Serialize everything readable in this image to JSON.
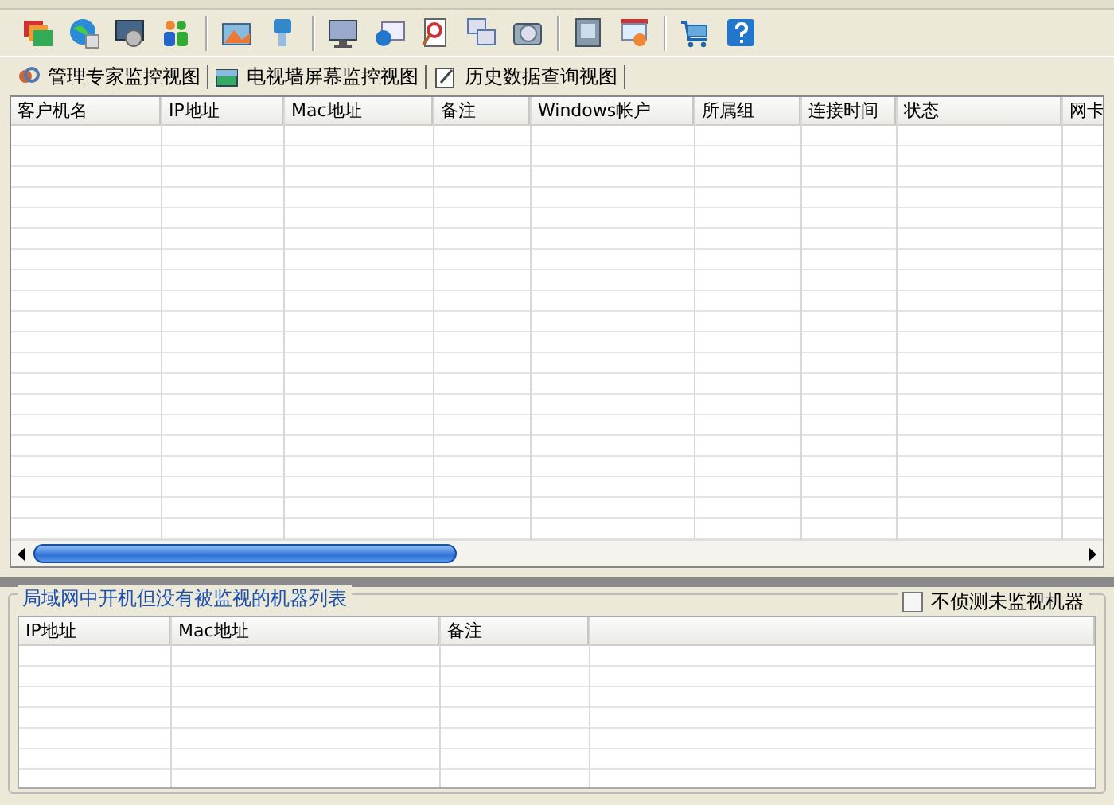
{
  "tabs": [
    {
      "label": "管理专家监控视图"
    },
    {
      "label": "电视墙屏幕监控视图"
    },
    {
      "label": "历史数据查询视图"
    }
  ],
  "main_table": {
    "columns": [
      "客户机名",
      "IP地址",
      "Mac地址",
      "备注",
      "Windows帐户",
      "所属组",
      "连接时间",
      "状态",
      "网卡"
    ]
  },
  "bottom_panel": {
    "title": "局域网中开机但没有被监视的机器列表",
    "checkbox": {
      "label": "不侦测未监视机器",
      "checked": false
    },
    "table": {
      "columns": [
        "IP地址",
        "Mac地址",
        "备注"
      ]
    }
  }
}
